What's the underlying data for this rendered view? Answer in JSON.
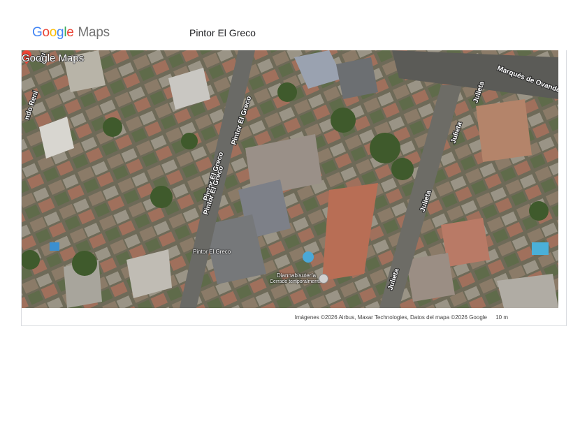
{
  "header": {
    "logo_text": "Google",
    "logo_suffix": "Maps",
    "place_title": "Pintor El Greco"
  },
  "map": {
    "type": "satellite",
    "streets": [
      "Pintor El Greco",
      "Pintor El Greco",
      "Pintor El Greco",
      "Julieta",
      "Julieta",
      "Julieta",
      "Julieta",
      "Marqués de Ovando",
      "Gu",
      "ndo Reni"
    ],
    "marker": {
      "label": "Pintor El Greco",
      "color": "#EA4335"
    },
    "poi": {
      "name": "Diannabisutería",
      "status": "Cerrado temporalmente"
    },
    "watermark": "Google Maps",
    "attribution": "Imágenes ©2026 Airbus, Maxar Technologies, Datos del mapa ©2026 Google",
    "scale": "10 m"
  }
}
